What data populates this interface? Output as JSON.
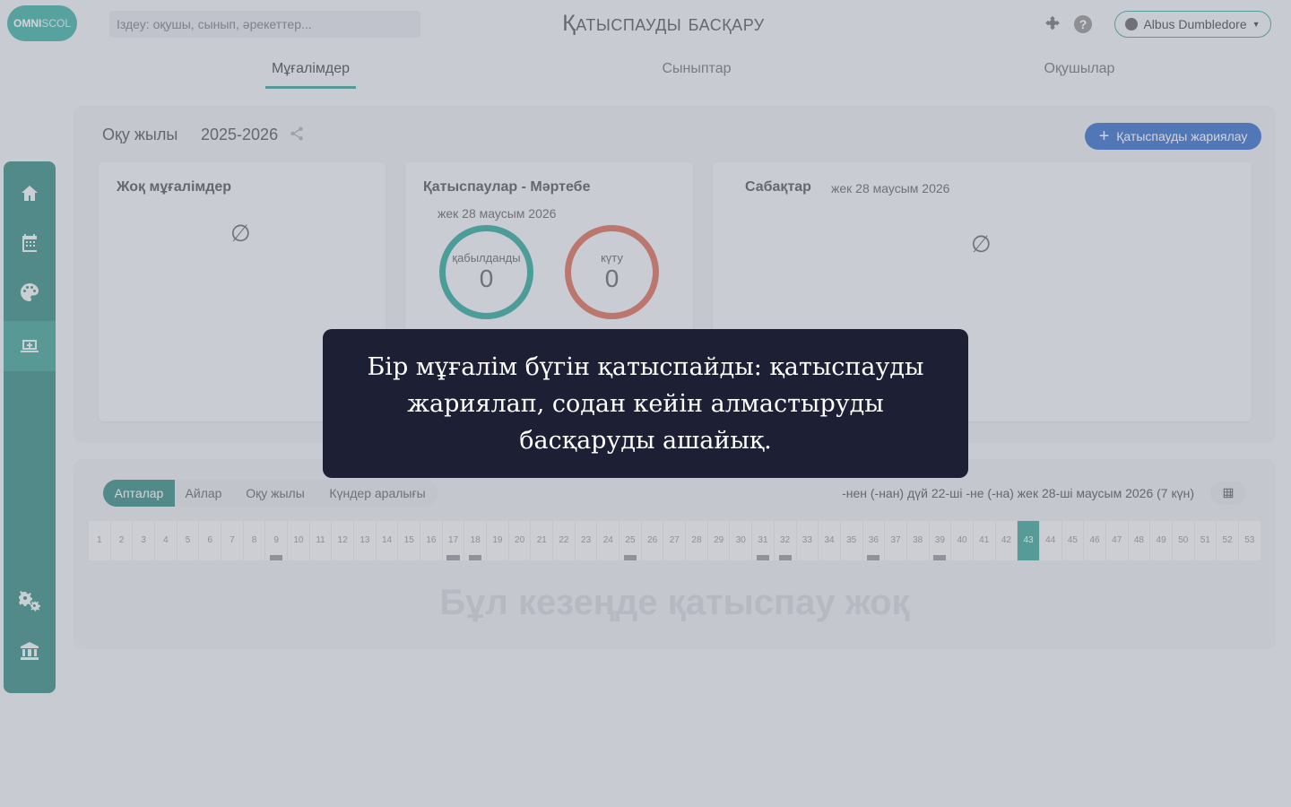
{
  "header": {
    "logo_bold": "OMNI",
    "logo_light": "SCOL",
    "search_placeholder": "Іздеу: оқушы, сынып, әрекеттер...",
    "title": "Қатыспауды басқару",
    "user_name": "Albus Dumbledore"
  },
  "tabs": [
    {
      "label": "Мұғалімдер",
      "active": true
    },
    {
      "label": "Сыныптар",
      "active": false
    },
    {
      "label": "Оқушылар",
      "active": false
    }
  ],
  "sidebar": {
    "items": [
      {
        "icon": "home-icon"
      },
      {
        "icon": "calendar-icon"
      },
      {
        "icon": "palette-icon"
      },
      {
        "icon": "laptop-add-icon",
        "active": true
      },
      {
        "icon": "gears-icon"
      },
      {
        "icon": "institution-icon"
      }
    ]
  },
  "main": {
    "year_label": "Оқу жылы",
    "year_value": "2025-2026",
    "declare_button": "Қатыспауды жариялау",
    "cards": {
      "absent_teachers": {
        "title": "Жоқ мұғалімдер",
        "empty": "∅"
      },
      "status": {
        "title": "Қатыспаулар - Мәртебе",
        "date": "жек 28 маусым 2026",
        "rings": [
          {
            "label": "қабылданды",
            "value": "0",
            "color": "#17a093"
          },
          {
            "label": "күту",
            "value": "0",
            "color": "#d65d45"
          }
        ]
      },
      "lessons": {
        "title": "Сабақтар",
        "date": "жек 28 маусым 2026",
        "empty": "∅"
      }
    }
  },
  "period": {
    "segments": [
      "Апталар",
      "Айлар",
      "Оқу жылы",
      "Күндер аралығы"
    ],
    "active_segment": "Апталар",
    "range_text": "-нен (-нан) дүй 22-ші -не (-на) жек 28-ші маусым 2026 (7 күн)",
    "weeks": [
      "1",
      "2",
      "3",
      "4",
      "5",
      "6",
      "7",
      "8",
      "9",
      "10",
      "11",
      "12",
      "13",
      "14",
      "15",
      "16",
      "17",
      "18",
      "19",
      "20",
      "21",
      "22",
      "23",
      "24",
      "25",
      "26",
      "27",
      "28",
      "29",
      "30",
      "31",
      "32",
      "33",
      "34",
      "35",
      "36",
      "37",
      "38",
      "39",
      "40",
      "41",
      "42",
      "43",
      "44",
      "45",
      "46",
      "47",
      "48",
      "49",
      "50",
      "51",
      "52",
      "53"
    ],
    "current_week": 43,
    "weeks_with_marks": [
      9,
      17,
      18,
      25,
      31,
      32,
      36,
      39
    ],
    "empty_message": "Бұл кезеңде қатыспау жоқ"
  },
  "tooltip": {
    "text": "Бір мұғалім бүгін қатыспайды: қатыспауды жариялап, содан кейін алмастыруды басқаруды ашайық."
  },
  "colors": {
    "accent": "#2a9d8f",
    "sidebar": "#227f76",
    "primary_button": "#1f5fc4",
    "tooltip_bg": "#1d2035"
  }
}
